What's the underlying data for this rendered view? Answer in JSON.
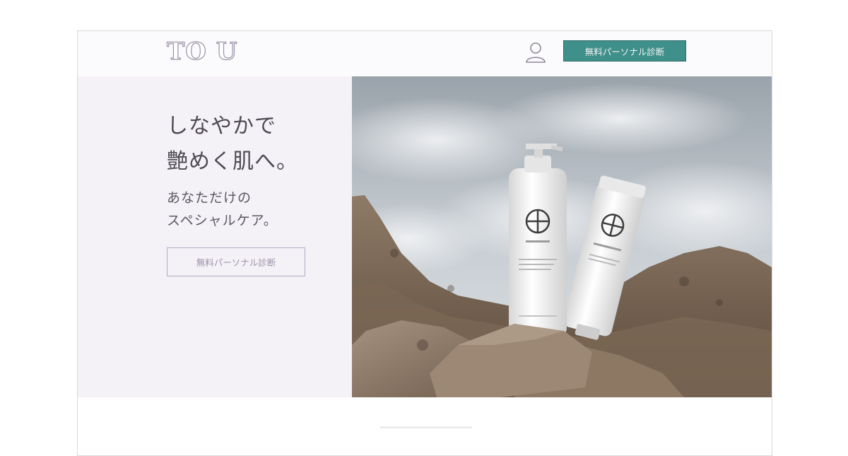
{
  "brand": {
    "logo_text": "TO U"
  },
  "header": {
    "cta_label": "無料パーソナル診断"
  },
  "hero": {
    "headline_lines": [
      "しなやかで",
      "艶めく肌へ。"
    ],
    "subline_lines": [
      "あなただけの",
      "スペシャルケア。"
    ],
    "cta_label": "無料パーソナル診断"
  },
  "colors": {
    "header_cta_bg": "#3f8f8a",
    "hero_left_bg": "#f5f2f7",
    "outline_button_border": "#b3a8c2"
  },
  "icons": {
    "account": "user-icon"
  }
}
